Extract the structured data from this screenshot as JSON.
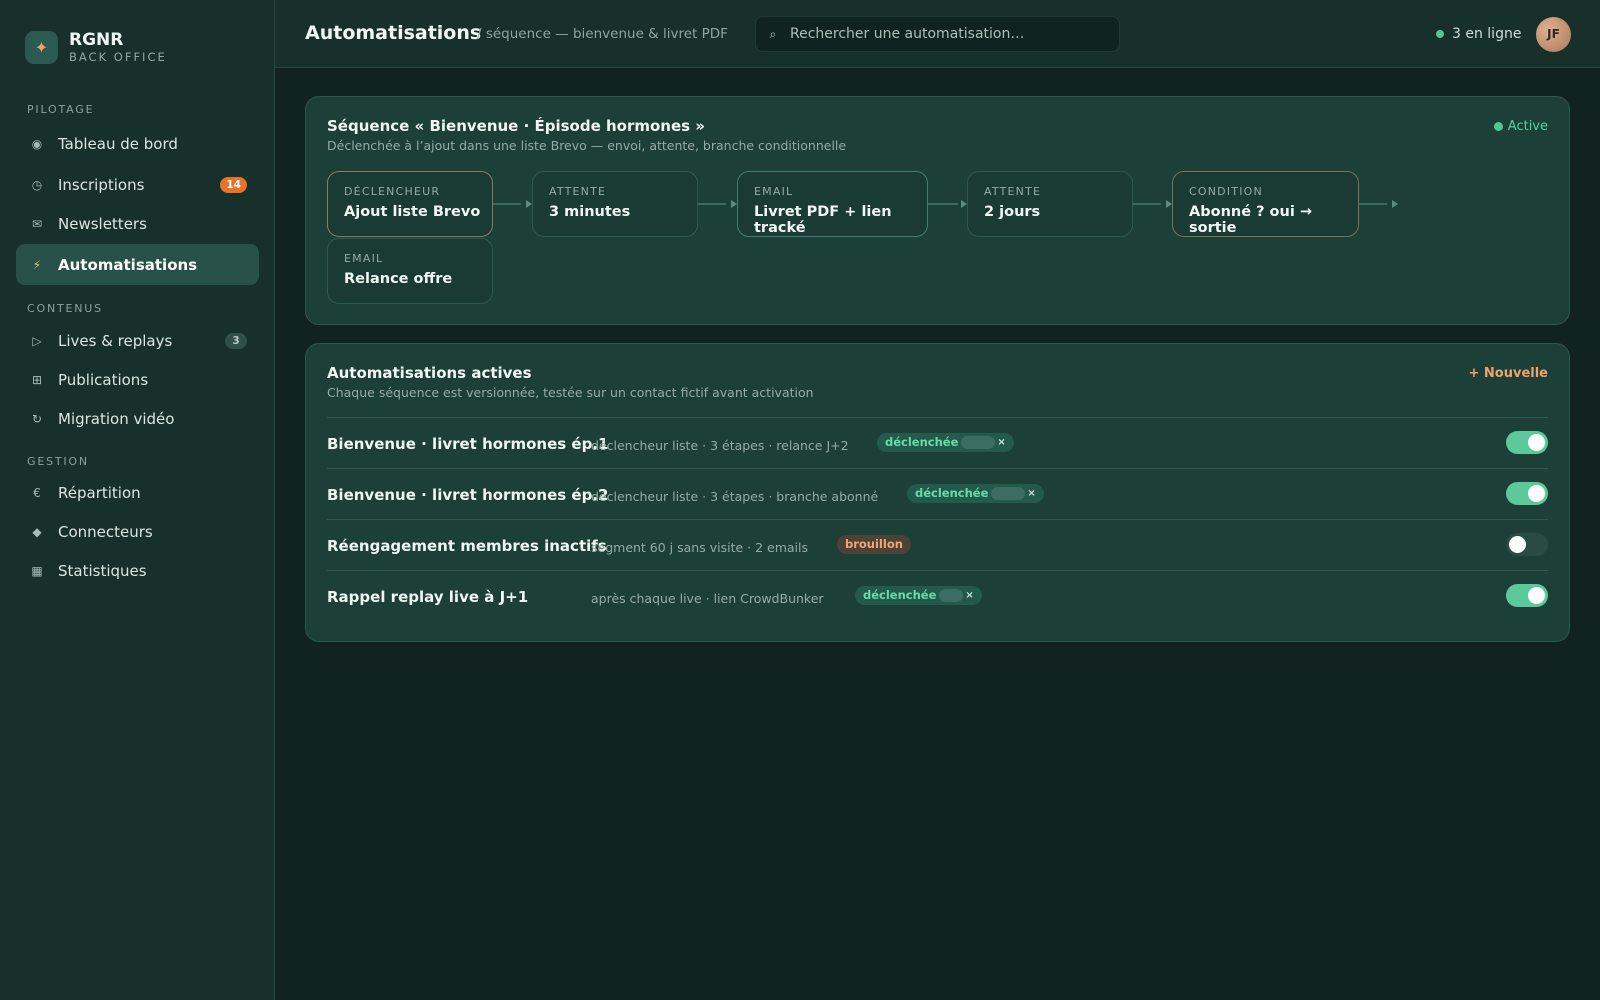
{
  "brand": {
    "logo_glyph": "✦",
    "name": "RGNR",
    "sub": "BACK OFFICE"
  },
  "sidebar": {
    "sections": [
      {
        "label": "PILOTAGE"
      },
      {
        "label": "CONTENUS"
      },
      {
        "label": "GESTION"
      }
    ],
    "items": [
      {
        "label": "Tableau de bord",
        "icon": "◉",
        "icon_name": "dashboard-icon"
      },
      {
        "label": "Inscriptions",
        "icon": "◷",
        "icon_name": "clock-icon",
        "badge": "14"
      },
      {
        "label": "Newsletters",
        "icon": "✉",
        "icon_name": "mail-icon"
      },
      {
        "label": "Automatisations",
        "icon": "⚡",
        "icon_name": "bolt-icon",
        "active": true
      },
      {
        "label": "Lives & replays",
        "icon": "▷",
        "icon_name": "play-icon",
        "badge": "3"
      },
      {
        "label": "Publications",
        "icon": "⊞",
        "icon_name": "grid-icon"
      },
      {
        "label": "Migration vidéo",
        "icon": "↻",
        "icon_name": "refresh-icon"
      },
      {
        "label": "Répartition",
        "icon": "€",
        "icon_name": "euro-icon"
      },
      {
        "label": "Connecteurs",
        "icon": "◆",
        "icon_name": "connector-icon"
      },
      {
        "label": "Statistiques",
        "icon": "▦",
        "icon_name": "chart-icon"
      }
    ]
  },
  "header": {
    "title": "Automatisations",
    "breadcrumb": "/ séquence — bienvenue & livret PDF",
    "search_placeholder": "Rechercher une automatisation…",
    "online": "3 en ligne",
    "avatar": "JF"
  },
  "sequence": {
    "title": "Séquence « Bienvenue · Épisode hormones »",
    "subtitle": "Déclenchée à l’ajout dans une liste Brevo — envoi, attente, branche conditionnelle",
    "status": "Active",
    "steps": [
      {
        "type": "DÉCLENCHEUR",
        "title": "Ajout liste Brevo"
      },
      {
        "type": "ATTENTE",
        "title": "3 minutes"
      },
      {
        "type": "EMAIL",
        "title": "Livret PDF + lien tracké"
      },
      {
        "type": "ATTENTE",
        "title": "2 jours"
      },
      {
        "type": "CONDITION",
        "title": "Abonné ? oui → sortie"
      },
      {
        "type": "EMAIL",
        "title": "Relance offre"
      }
    ]
  },
  "automations": {
    "title": "Automatisations actives",
    "subtitle": "Chaque séquence est versionnée, testée sur un contact fictif avant activation",
    "new_label": "+ Nouvelle",
    "rows": [
      {
        "name": "Bienvenue · livret hormones ép.1",
        "meta": "déclencheur liste · 3 étapes · relance J+2",
        "tag": "déclenchée",
        "tag_close": "×",
        "enabled": true
      },
      {
        "name": "Bienvenue · livret hormones ép.2",
        "meta": "déclencheur liste · 3 étapes · branche abonné",
        "tag": "déclenchée",
        "tag_close": "×",
        "enabled": true
      },
      {
        "name": "Réengagement membres inactifs",
        "meta": "segment 60 j sans visite · 2 emails",
        "tag": "brouillon",
        "enabled": false
      },
      {
        "name": "Rappel replay live à J+1",
        "meta": "après chaque live · lien CrowdBunker",
        "tag": "déclenchée",
        "tag_close": "×",
        "enabled": true
      }
    ]
  },
  "colors": {
    "accent": "#5cc99a",
    "warning": "#e8722a",
    "brand_orange": "#f0a36b"
  }
}
